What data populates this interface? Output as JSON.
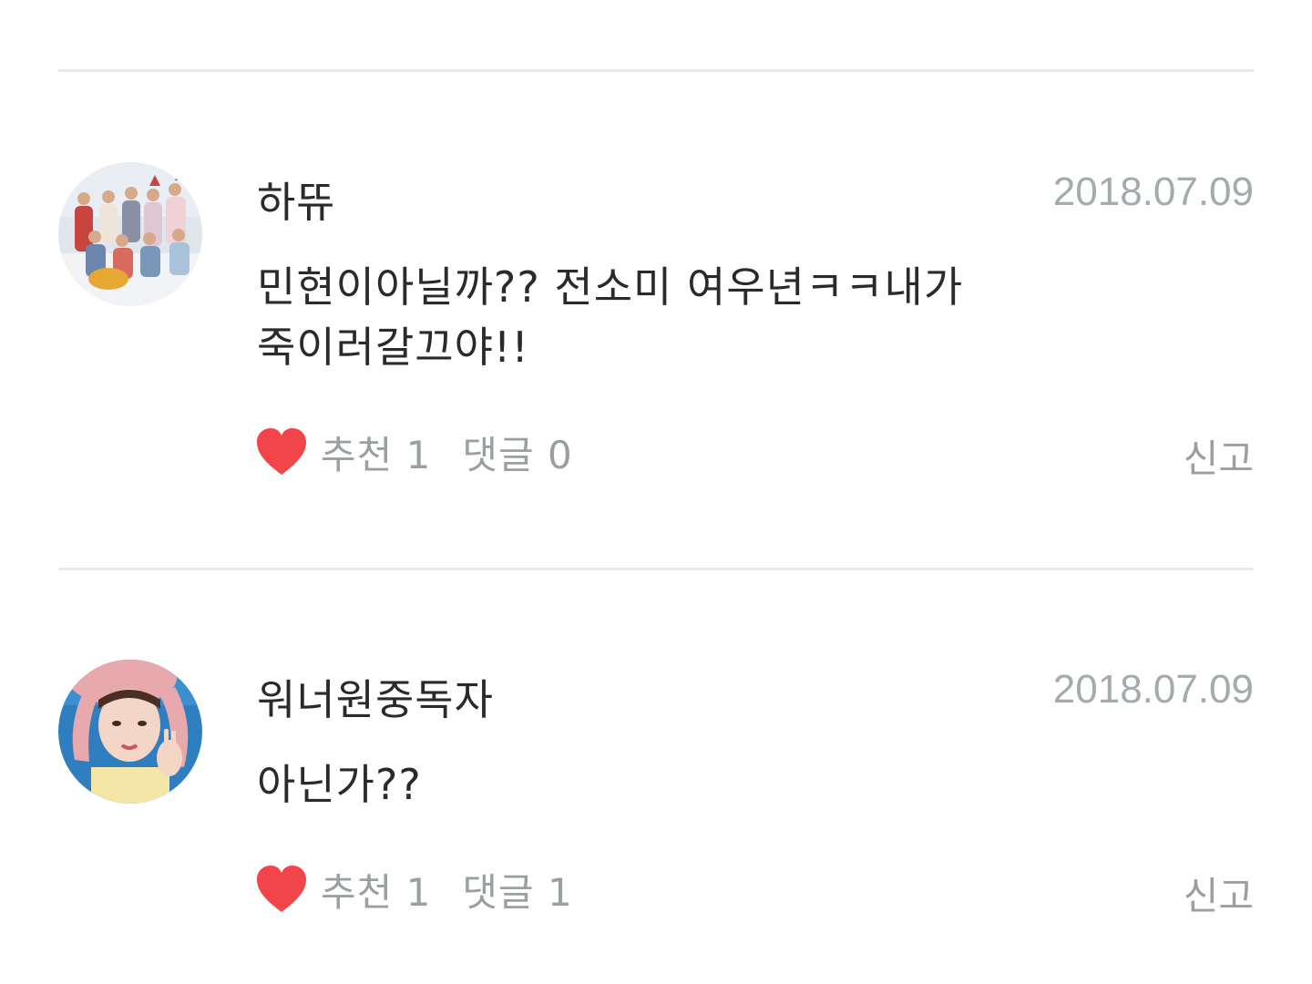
{
  "comments": [
    {
      "author": "하뜌",
      "date": "2018.07.09",
      "body_lines": [
        "민현이아닐까??  전소미 여우년ㅋㅋ내가",
        "죽이러갈끄야!!"
      ],
      "like_text": "추천 1",
      "reply_text": "댓글 0",
      "report_label": "신고"
    },
    {
      "author": "워너원중독자",
      "date": "2018.07.09",
      "body_lines": [
        "아닌가??"
      ],
      "like_text": "추천 1",
      "reply_text": "댓글 1",
      "report_label": "신고"
    }
  ],
  "colors": {
    "heart": "#f2454a",
    "muted": "#9a9fa1",
    "divider": "#e6eaea"
  },
  "icons": {
    "like": "heart-icon"
  }
}
